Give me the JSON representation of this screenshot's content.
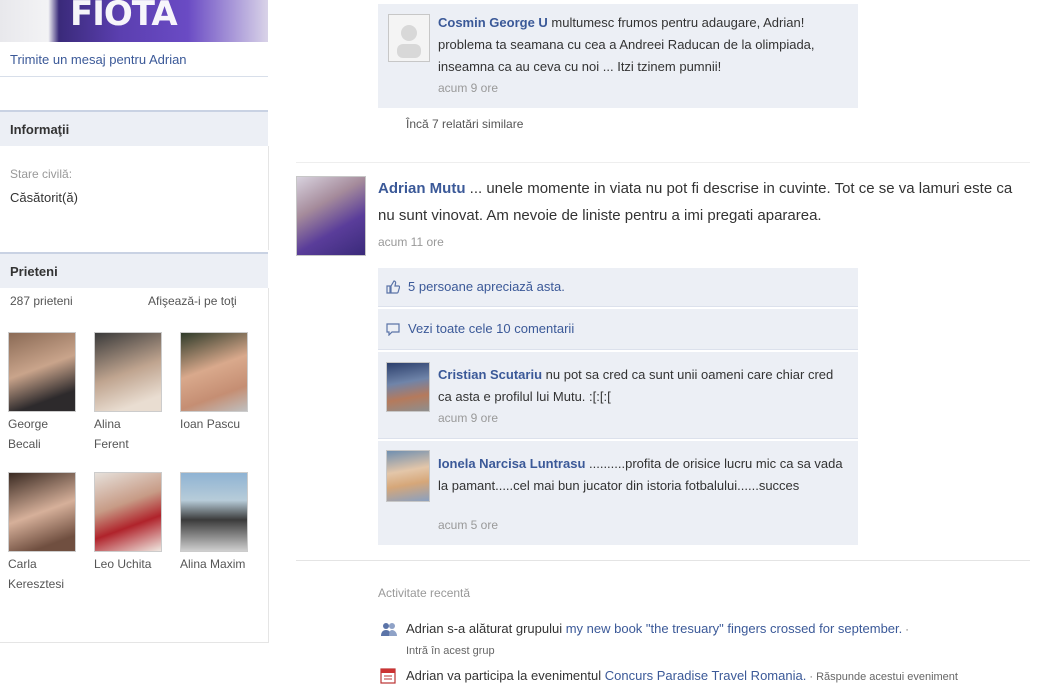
{
  "left": {
    "send_message": "Trimite un mesaj pentru Adrian",
    "info_header": "Informaţii",
    "marital_label": "Stare civilă:",
    "marital_value": "Căsătorit(ă)",
    "friends_header": "Prieteni",
    "friends_count": "287 prieteni",
    "friends_show_all": "Afişează-i pe toţi",
    "friends": [
      {
        "first": "George",
        "last": "Becali"
      },
      {
        "first": "Alina",
        "last": "Ferent"
      },
      {
        "first": "Ioan Pascu",
        "last": ""
      },
      {
        "first": "Carla",
        "last": "Keresztesi"
      },
      {
        "first": "Leo Uchita",
        "last": ""
      },
      {
        "first": "Alina Maxim",
        "last": ""
      }
    ]
  },
  "top_comment": {
    "author": "Cosmin George U",
    "text": " multumesc frumos pentru adaugare, Adrian! problema ta seamana cu cea a Andreei Raducan de la olimpiada, inseamna ca au ceva cu noi ... Itzi tzinem pumnii!",
    "time": "acum 9 ore"
  },
  "similar_link": "Încă 7 relatări similare",
  "post": {
    "author": "Adrian Mutu",
    "text": " ... unele momente in viata nu pot fi descrise in cuvinte. Tot ce se va lamuri este ca nu sunt vinovat. Am nevoie de liniste pentru a imi pregati apararea.",
    "time": "acum 11 ore",
    "likes": "5 persoane apreciază asta.",
    "view_all_comments": "Vezi toate cele 10 comentarii",
    "comments": [
      {
        "author": "Cristian Scutariu",
        "text": " nu pot sa cred ca sunt unii oameni care chiar cred ca asta e profilul lui Mutu. :[:[:[",
        "time": "acum 9 ore"
      },
      {
        "author": "Ionela Narcisa Luntrasu",
        "text": " ..........profita de orisice lucru mic ca sa vada la pamant.....cel mai bun jucator din istoria fotbalului......succes",
        "time": "acum 5 ore"
      }
    ]
  },
  "recent": {
    "title": "Activitate recentă",
    "items": [
      {
        "icon": "group-icon",
        "prefix": "Adrian s-a alăturat grupului ",
        "link": "my new book \"the tresuary\" fingers crossed for september.",
        "action": " · Intră în acest grup"
      },
      {
        "icon": "calendar-icon",
        "prefix": "Adrian va participa la evenimentul ",
        "link": "Concurs Paradise Travel Romania.",
        "action": " · Răspunde acestui eveniment"
      }
    ]
  },
  "colors": {
    "link_blue": "#3b5998",
    "comment_bg": "#eceff5",
    "header_bg": "#eceff5"
  }
}
